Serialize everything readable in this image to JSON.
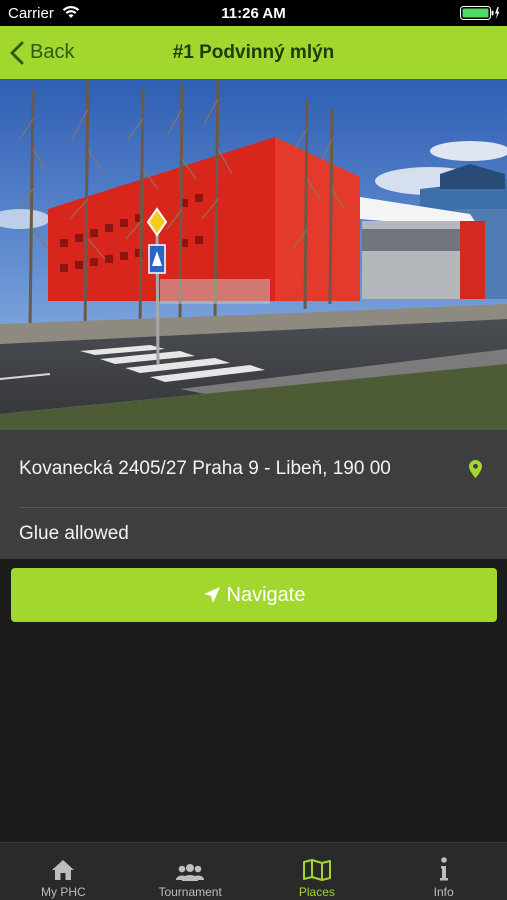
{
  "status_bar": {
    "carrier": "Carrier",
    "time": "11:26 AM"
  },
  "nav": {
    "back_label": "Back",
    "title": "#1 Podvinný mlýn"
  },
  "place": {
    "address": "Kovanecká 2405/27 Praha 9 - Libeň, 190 00",
    "note": "Glue allowed"
  },
  "actions": {
    "navigate_label": "Navigate"
  },
  "tabs": [
    {
      "label": "My PHC",
      "icon": "home-icon",
      "active": false
    },
    {
      "label": "Tournament",
      "icon": "group-icon",
      "active": false
    },
    {
      "label": "Places",
      "icon": "map-icon",
      "active": true
    },
    {
      "label": "Info",
      "icon": "info-icon",
      "active": false
    }
  ],
  "colors": {
    "accent": "#a2d82e",
    "background": "#1c1c1c",
    "panel": "#3e3e3e",
    "tab_bar": "#2a2a2a"
  }
}
